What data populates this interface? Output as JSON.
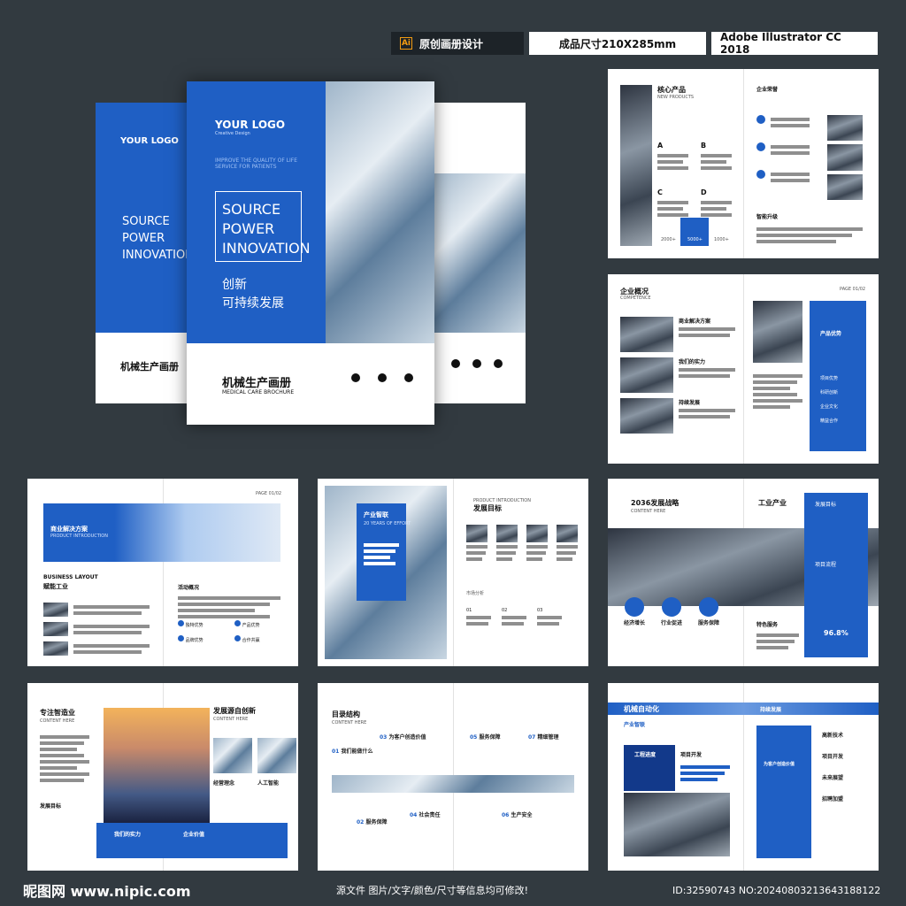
{
  "tags": {
    "original": "原创画册设计",
    "ai": "Ai",
    "size": "成品尺寸210X285mm",
    "software": "Adobe Illustrator CC 2018"
  },
  "cover": {
    "logo": "YOUR LOGO",
    "logo_sub": "Creative Design",
    "tagline": "IMPROVE THE QUALITY OF LIFE SERVICE FOR PATIENTS",
    "headline": [
      "SOURCE",
      "POWER",
      "INNOVATION"
    ],
    "cn1": "创新",
    "cn2": "可持续发展",
    "title": "机械生产画册",
    "subtitle": "MEDICAL CARE BROCHURE",
    "icons": [
      "Telephone",
      "E-mail",
      "QQ Message"
    ]
  },
  "p1": {
    "title": "核心产品",
    "sub": "NEW PRODUCTS",
    "right_title": "企业荣誉",
    "bottom": "智能升级",
    "letters": [
      "A",
      "B",
      "C",
      "D"
    ],
    "stats": [
      "2000+",
      "5000+",
      "1000+"
    ]
  },
  "p2": {
    "title": "企业概况",
    "sub": "COMPETENCE",
    "page": "PAGE 01/02",
    "items": [
      "商业解决方案",
      "我们的实力",
      "持续发展"
    ],
    "panel": "产品优势",
    "panel_items": [
      "项目优势",
      "科研创新",
      "企业文化",
      "精益合作"
    ]
  },
  "p3": {
    "page": "PAGE 01/02",
    "banner": "商业解决方案",
    "banner_sub": "PRODUCT INTRODUCTION",
    "h1": "BUSINESS LAYOUT",
    "h2": "赋能工业",
    "right": "活动概况",
    "items": [
      "独特优势",
      "产品优势",
      "品牌优势",
      "合作共赢"
    ]
  },
  "p4": {
    "box": "产业智联",
    "box_sub": "20 YEARS OF EFFORT",
    "r_sub": "PRODUCT INTRODUCTION",
    "r_title": "发展目标",
    "block": "市场分析",
    "nums": [
      "01",
      "02",
      "03"
    ]
  },
  "p5": {
    "title": "2036发展战略",
    "sub": "CONTENT HERE",
    "right": "工业产业",
    "items": [
      "发展目标",
      "项目流程"
    ],
    "bottom": [
      "经济增长",
      "行业促进",
      "服务保障"
    ],
    "extra": "特色服务",
    "pct": "96.8%"
  },
  "p6": {
    "title": "专注智造业",
    "sub": "CONTENT HERE",
    "right": "发展源自创新",
    "right_sub": "CONTENT HERE",
    "labels": [
      "经营理念",
      "人工智能"
    ],
    "left2": "发展目标",
    "band": [
      "我们的实力",
      "企业价值"
    ]
  },
  "p7": {
    "title": "目录结构",
    "sub": "CONTENT HERE",
    "items": [
      {
        "n": "01",
        "t": "我们能做什么"
      },
      {
        "n": "02",
        "t": "服务保障"
      },
      {
        "n": "03",
        "t": "为客户创造价值"
      },
      {
        "n": "04",
        "t": "社会责任"
      },
      {
        "n": "05",
        "t": "服务保障"
      },
      {
        "n": "06",
        "t": "生产安全"
      },
      {
        "n": "07",
        "t": "精细管理"
      }
    ]
  },
  "p8": {
    "title": "机械自动化",
    "sub": "产业智联",
    "right": "持续发展",
    "box": "工程进度",
    "box2": "项目开发",
    "panel": "为客户创造价值",
    "list": [
      "高新技术",
      "项目开发",
      "未来展望",
      "招聘加盟"
    ]
  },
  "footer": {
    "logo": "昵图网 www.nipic.com",
    "note": "源文件 图片/文字/颜色/尺寸等信息均可修改!",
    "id": "ID:32590743 NO:20240803213643188122"
  }
}
